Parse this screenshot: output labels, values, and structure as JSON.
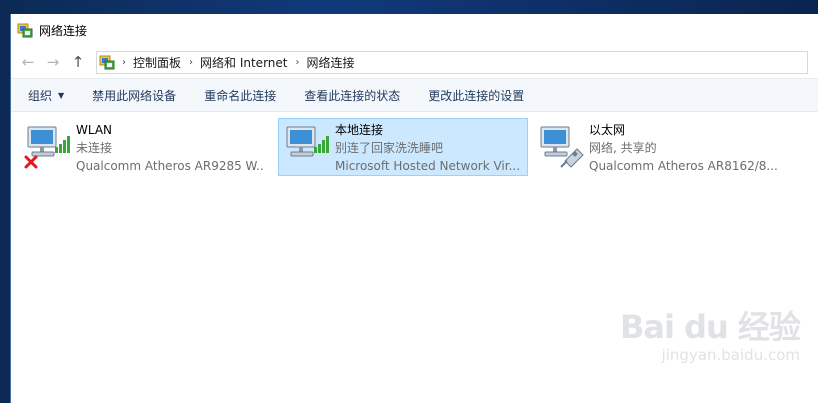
{
  "window": {
    "title": "网络连接"
  },
  "nav": {
    "back_icon": "arrow-left-icon",
    "forward_icon": "arrow-right-icon",
    "up_icon": "arrow-up-icon"
  },
  "address": {
    "segments": [
      "控制面板",
      "网络和 Internet",
      "网络连接"
    ]
  },
  "commands": {
    "organize": "组织",
    "disable": "禁用此网络设备",
    "rename": "重命名此连接",
    "view_status": "查看此连接的状态",
    "change_settings": "更改此连接的设置"
  },
  "connections": [
    {
      "name": "WLAN",
      "status": "未连接",
      "device": "Qualcomm Atheros AR9285 W...",
      "type": "wireless",
      "state": "disconnected",
      "selected": false
    },
    {
      "name": "本地连接",
      "status": "别连了回家洗洗睡吧",
      "device": "Microsoft Hosted Network Vir...",
      "type": "wireless",
      "state": "connected",
      "selected": true
    },
    {
      "name": "以太网",
      "status": "网络, 共享的",
      "device": "Qualcomm Atheros AR8162/8...",
      "type": "ethernet",
      "state": "connected",
      "selected": false
    }
  ],
  "watermark": {
    "brand": "Bai du 经验",
    "url": "jingyan.baidu.com"
  },
  "colors": {
    "selection_bg": "#cce8ff",
    "selection_border": "#99d1ff",
    "command_text": "#1e395b",
    "signal_green": "#3aa63a",
    "error_red": "#e3171d"
  }
}
